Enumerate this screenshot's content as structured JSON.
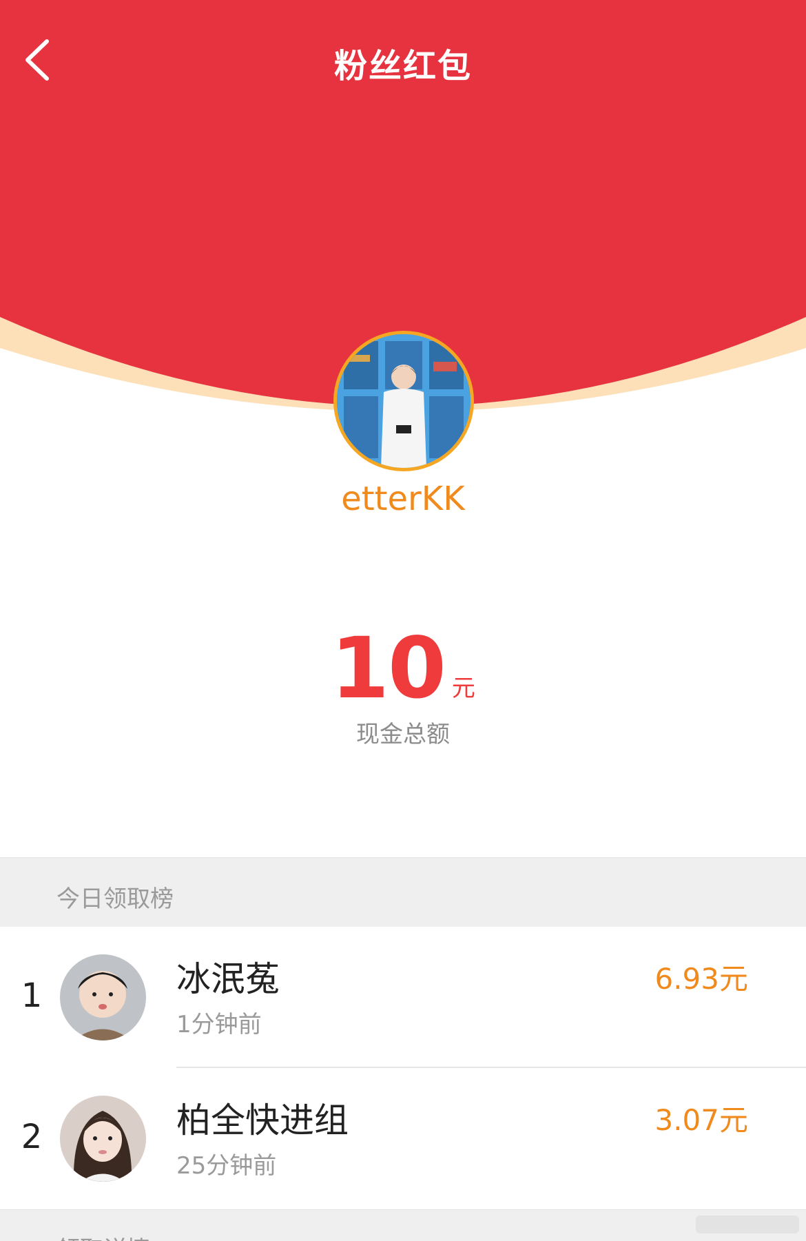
{
  "nav": {
    "title": "粉丝红包",
    "back_icon": "chevron-left-icon"
  },
  "sender": {
    "name": "etterKK"
  },
  "amount": {
    "value": "10",
    "unit": "元",
    "label": "现金总额"
  },
  "leaderboard": {
    "title": "今日领取榜",
    "rows": [
      {
        "rank": "1",
        "name": "冰泯菟",
        "time": "1分钟前",
        "amount": "6.93元"
      },
      {
        "rank": "2",
        "name": "柏全快进组",
        "time": "25分钟前",
        "amount": "3.07元"
      }
    ]
  },
  "next_section": {
    "title": "领取详情"
  },
  "colors": {
    "hero_red": "#e6333f",
    "hero_rim": "#fde0b8",
    "accent_orange": "#f08a1c",
    "amount_red": "#ef3b3b",
    "avatar_ring": "#f5a623"
  }
}
